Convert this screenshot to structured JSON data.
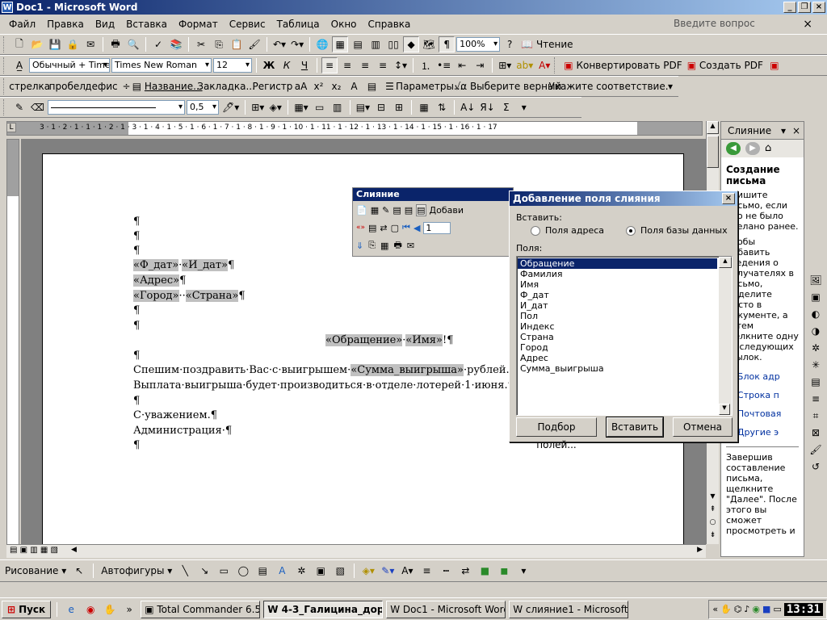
{
  "window": {
    "title": "Doc1 - Microsoft Word"
  },
  "menu": {
    "items": [
      "Файл",
      "Правка",
      "Вид",
      "Вставка",
      "Формат",
      "Сервис",
      "Таблица",
      "Окно",
      "Справка"
    ],
    "ask_placeholder": "Введите вопрос"
  },
  "toolbar1": {
    "zoom": "100%",
    "reading": "Чтение"
  },
  "toolbar2": {
    "style": "Обычный + Time",
    "font": "Times New Roman",
    "size": "12",
    "bold": "Ж",
    "italic": "К",
    "underline": "Ч",
    "convert_pdf": "Конвертировать PDF",
    "create_pdf": "Создать PDF"
  },
  "toolbar3": {
    "items": [
      "стрелка",
      "пробел",
      "дефис",
      "÷",
      "Название...",
      "Закладка...",
      "Регистр",
      "Параметры...",
      "Выберите верный",
      "Укажите соответствие."
    ]
  },
  "toolbar4": {
    "line_width": "0,5"
  },
  "ruler": {
    "numbers": "3 · 1 · 2 · 1 · 1 · 1 · 2 · 1 · 3 · 1 · 4 · 1 · 5 · 1 · 6 · 1 · 7 · 1 · 8 · 1 · 9 · 1 · 10 · 1 · 11 · 1 · 12 · 1 · 13 · 1 · 14 · 1 · 15 · 1 · 16 · 1 · 17"
  },
  "document": {
    "para": "¶",
    "f_dat": "«Ф_дат»",
    "i_dat": "«И_дат»",
    "address": "«Адрес»",
    "city": "«Город»",
    "country": "«Страна»",
    "greeting_field1": "«Обращение»",
    "greeting_field2": "«Имя»",
    "greeting_end": "!¶",
    "line1_text": "Спешим·поздравить·Вас·с·выигрышем·",
    "line1_field": "«Сумма_выигрыша»",
    "line1_end": "·рублей.",
    "line2": "Выплата·выигрыша·будет·производиться·в·отделе·лотерей·1·июня.¶",
    "regards": "С·уважением.¶",
    "admin": "Администрация·¶"
  },
  "merge_toolbar": {
    "title": "Слияние",
    "insert_label": "Добави",
    "record": "1"
  },
  "dialog": {
    "title": "Добавление поля слияния",
    "insert_label": "Вставить:",
    "radio_address": "Поля адреса",
    "radio_db": "Поля базы данных",
    "fields_label": "Поля:",
    "fields": [
      "Обращение",
      "Фамилия",
      "Имя",
      "Ф_дат",
      "И_дат",
      "Пол",
      "Индекс",
      "Страна",
      "Город",
      "Адрес",
      "Сумма_выигрыша"
    ],
    "selected_field": "Обращение",
    "btn_match": "Подбор полей...",
    "btn_insert": "Вставить",
    "btn_cancel": "Отмена"
  },
  "taskpane": {
    "title": "Слияние",
    "heading": "Создание письма",
    "text1": "апишите письмо, если оно не было сделано ранее.",
    "text2": "Чтобы добавить сведения о получателях в письмо, выделите место в документе, а затем щелкните одну из следующих ссылок.",
    "links": [
      "Блок адр",
      "Строка п",
      "Почтовая",
      "Другие э"
    ],
    "footer": "Завершив составление письма, щелкните \"Далее\". После этого вы сможет просмотреть и"
  },
  "drawbar": {
    "drawing": "Рисование",
    "autoshapes": "Автофигуры"
  },
  "taskbar": {
    "start": "Пуск",
    "buttons": [
      "Total Commander 6.53 ...",
      "4-3_Галицина_дор...",
      "Doc1 - Microsoft Word",
      "слияние1 - Microsoft ..."
    ],
    "clock": "13:31"
  }
}
